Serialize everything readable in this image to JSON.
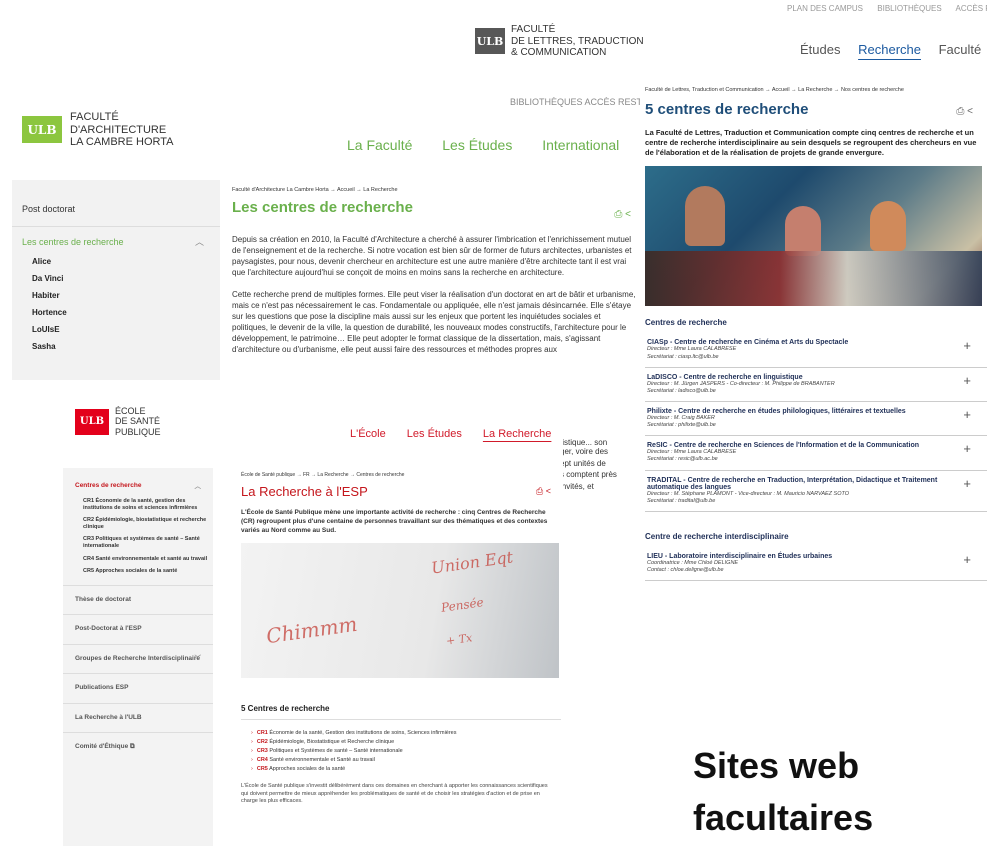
{
  "lettres": {
    "top_links": [
      "PLAN DES CAMPUS",
      "BIBLIOTHÈQUES",
      "ACCÈS RESTREINT"
    ],
    "logo_mark": "ULB",
    "logo_lines": [
      "FACULTÉ",
      "DE LETTRES, TRADUCTION",
      "& COMMUNICATION"
    ],
    "nav": [
      "Études",
      "Recherche",
      "Faculté"
    ],
    "breadcrumb": "Faculté de Lettres, Traduction et Communication → Accueil → La Recherche → Nos centres de recherche",
    "title": "5 centres de recherche",
    "tools": "⎙ <",
    "intro": "La Faculté de Lettres, Traduction et Communication compte cinq centres de recherche et un centre de recherche interdisciplinaire au sein desquels se regroupent des chercheurs en vue de l'élaboration et de la réalisation de projets de grande envergure.",
    "section_centres": "Centres de recherche",
    "centres": [
      {
        "title": "CIASp - Centre de recherche en Cinéma et Arts du Spectacle",
        "lines": [
          "Directeur : Mme Laura CALABRESE",
          "Secrétariat : ciasp.ltc@ulb.be"
        ]
      },
      {
        "title": "LaDISCO - Centre de recherche en linguistique",
        "lines": [
          "Directeur : M. Jürgen JASPERS - Co-directeur : M. Philippe de BRABANTER",
          "Secrétariat : ladisco@ulb.be"
        ]
      },
      {
        "title": "Philixte - Centre de recherche en études philologiques, littéraires et textuelles",
        "lines": [
          "Directeur : M. Craig BAKER",
          "Secrétariat : philixte@ulb.be"
        ]
      },
      {
        "title": "ReSIC - Centre de recherche en Sciences de l'Information et de la Communication",
        "lines": [
          "Directeur : Mme Laura CALABRESE",
          "Secrétariat : resic@ulb.ac.be"
        ]
      },
      {
        "title": "TRADITAL - Centre de recherche en Traduction, Interprétation, Didactique et Traitement automatique des langues",
        "lines": [
          "Directeur : M. Stéphane PLAMONT - Vice-directeur : M. Mauricio NARVAEZ SOTO",
          "Secrétariat : tradital@ulb.be"
        ]
      }
    ],
    "section_interdisciplinaire": "Centre de recherche interdisciplinaire",
    "interdisciplinaire": [
      {
        "title": "LIEU - Laboratoire interdisciplinaire en Études urbaines",
        "lines": [
          "Coordinatrice : Mme Chloé DELIGNE",
          "Contact : chloe.deligne@ulb.be"
        ]
      }
    ],
    "plus": "+"
  },
  "architecture": {
    "ghost_links": "BIBLIOTHÈQUES    ACCÈS RESTREINT",
    "logo_mark": "ULB",
    "logo_lines": [
      "FACULTÉ",
      "D'ARCHITECTURE",
      "LA CAMBRE HORTA"
    ],
    "nav": [
      "La Faculté",
      "Les Études",
      "International"
    ],
    "sidebar_post": "Post doctorat",
    "sidebar_current": "Les centres de recherche",
    "sidebar_links": [
      "Alice",
      "Da Vinci",
      "Habiter",
      "Hortence",
      "LoUIsE",
      "Sasha"
    ],
    "breadcrumb": "Faculté d'Architecture La Cambre Horta → Accueil → La Recherche",
    "title": "Les centres de recherche",
    "tools": "⎙ <",
    "paragraphs": [
      "Depuis sa création en 2010, la Faculté d'Architecture a cherché à assurer l'imbrication et l'enrichissement mutuel de l'enseignement et de la recherche. Si notre vocation est bien sûr de former de futurs architectes, urbanistes et paysagistes, pour nous, devenir chercheur en architecture est une autre manière d'être architecte tant il est vrai que l'architecture aujourd'hui se conçoit de moins en moins sans la recherche en architecture.",
      "Cette recherche prend de multiples formes. Elle peut viser la réalisation d'un doctorat en art de bâtir et urbanisme, mais ce n'est pas nécessairement le cas. Fondamentale ou appliquée, elle n'est jamais désincarnée. Elle s'étaye sur les questions que pose la discipline mais aussi sur les enjeux que portent les inquiétudes sociales et politiques, le devenir de la ville, la question de durabilité, les nouveaux modes constructifs, l'architecture pour le développement, le patrimoine… Elle peut adopter le format classique de la dissertation, mais, s'agissant d'architecture ou d'urbanisme, elle peut aussi faire des ressources et méthodes propres aux"
    ],
    "peek_lines": [
      "tistique... son",
      "ger, voire des",
      "ept unités de",
      "s comptent près",
      "invités, et"
    ]
  },
  "esp": {
    "logo_mark": "ULB",
    "logo_lines": [
      "ÉCOLE",
      "DE SANTÉ",
      "PUBLIQUE"
    ],
    "nav": [
      "L'École",
      "Les Études",
      "La Recherche"
    ],
    "side_head": "Centres de recherche",
    "side_centres": [
      "CR1 Économie de la santé, gestion des institutions de soins et sciences infirmières",
      "CR2 Épidémiologie, biostatistique et recherche clinique",
      "CR3 Politiques et systèmes de santé – Santé internationale",
      "CR4 Santé environnementale et santé au travail",
      "CR5 Approches sociales de la santé"
    ],
    "side_rows": [
      "Thèse de doctorat",
      "Post-Doctorat à l'ESP",
      "Groupes de Recherche Interdisciplinaire",
      "Publications ESP",
      "La Recherche à l'ULB",
      "Comité d'Éthique ⧉"
    ],
    "breadcrumb": "École de Santé publique → FR → La Recherche → Centres de recherche",
    "title": "La Recherche à l'ESP",
    "tools": "⎙ <",
    "intro": "L'École de Santé Publique mène une importante activité de recherche : cinq Centres de Recherche (CR) regroupent plus d'une centaine de personnes travaillant sur des thématiques et des contextes variés au Nord comme au Sud.",
    "whiteboard": [
      "Union Eqt",
      "Chimmm",
      "Pensée",
      "+ Tx"
    ],
    "h2": "5 Centres de recherche",
    "cr_list": [
      {
        "code": "CR1",
        "text": "Économie de la santé, Gestion des institutions de soins, Sciences infirmières"
      },
      {
        "code": "CR2",
        "text": "Épidémiologie, Biostatistique et Recherche clinique"
      },
      {
        "code": "CR3",
        "text": "Politiques et Systèmes de santé – Santé internationale"
      },
      {
        "code": "CR4",
        "text": "Santé environnementale et Santé au travail"
      },
      {
        "code": "CR5",
        "text": "Approches sociales de la santé"
      }
    ],
    "outro": "L'École de Santé publique s'investit délibérément dans ces domaines en cherchant à apporter les connaissances scientifiques qui doivent permettre de mieux appréhender les problématiques de santé et de choisir les stratégies d'action et de prise en charge les plus efficaces."
  },
  "caption": [
    "Sites web",
    "facultaires"
  ]
}
